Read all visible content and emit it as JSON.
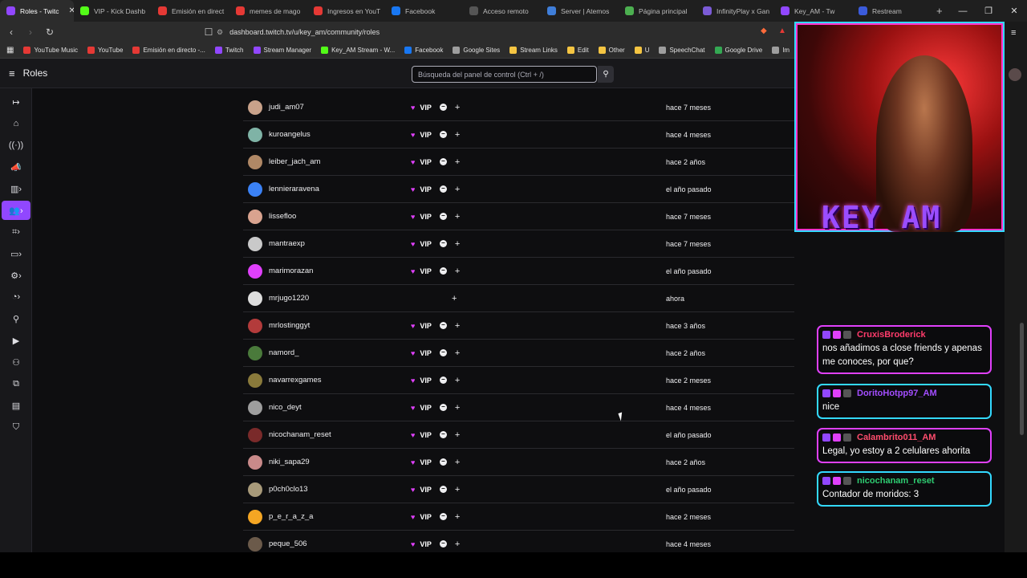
{
  "tabs": [
    {
      "label": "Roles - Twitc",
      "color": "#9147ff",
      "active": true
    },
    {
      "label": "VIP - Kick Dashb",
      "color": "#53fc18"
    },
    {
      "label": "Emisión en direct",
      "color": "#e53935"
    },
    {
      "label": "memes de mago",
      "color": "#e53935"
    },
    {
      "label": "Ingresos en YouT",
      "color": "#e53935"
    },
    {
      "label": "Facebook",
      "color": "#1877f2"
    },
    {
      "label": "Acceso remoto",
      "color": "#555555"
    },
    {
      "label": "Server | Atemos",
      "color": "#3f7ed9"
    },
    {
      "label": "Página principal",
      "color": "#4caf50"
    },
    {
      "label": "InfinityPlay x Gan",
      "color": "#7b5bd6"
    },
    {
      "label": "Key_AM - Tw",
      "color": "#9147ff"
    },
    {
      "label": "Restream",
      "color": "#3b5bdb"
    }
  ],
  "address": {
    "url": "dashboard.twitch.tv/u/key_am/community/roles"
  },
  "bookmarks": [
    {
      "label": "YouTube Music",
      "color": "#e53935"
    },
    {
      "label": "YouTube",
      "color": "#e53935"
    },
    {
      "label": "Emisión en directo -...",
      "color": "#e53935"
    },
    {
      "label": "Twitch",
      "color": "#9147ff"
    },
    {
      "label": "Stream Manager",
      "color": "#9147ff"
    },
    {
      "label": "Key_AM Stream - W...",
      "color": "#53fc18"
    },
    {
      "label": "Facebook",
      "color": "#1877f2"
    },
    {
      "label": "Google Sites",
      "color": "#9e9e9e"
    },
    {
      "label": "Stream Links",
      "color": "#f5c542"
    },
    {
      "label": "Edit",
      "color": "#f5c542"
    },
    {
      "label": "Other",
      "color": "#f5c542"
    },
    {
      "label": "U",
      "color": "#f5c542"
    },
    {
      "label": "SpeechChat",
      "color": "#9e9e9e"
    },
    {
      "label": "Google Drive",
      "color": "#34a853"
    },
    {
      "label": "Im",
      "color": "#9e9e9e"
    }
  ],
  "header": {
    "title": "Roles",
    "search_placeholder": "Búsqueda del panel de control (Ctrl + /)"
  },
  "roles": [
    {
      "user": "judi_am07",
      "vip": true,
      "date": "hace 7 meses",
      "avatar": "#c9a28a"
    },
    {
      "user": "kuroangelus",
      "vip": true,
      "date": "hace 4 meses",
      "avatar": "#7fb3a6"
    },
    {
      "user": "leiber_jach_am",
      "vip": true,
      "date": "hace 2 años",
      "avatar": "#b08866"
    },
    {
      "user": "lennieraravena",
      "vip": true,
      "date": "el año pasado",
      "avatar": "#3b82f6"
    },
    {
      "user": "lissefloo",
      "vip": true,
      "date": "hace 7 meses",
      "avatar": "#d9a38f"
    },
    {
      "user": "mantraexp",
      "vip": true,
      "date": "hace 7 meses",
      "avatar": "#c9c9c9"
    },
    {
      "user": "marimorazan",
      "vip": true,
      "date": "el año pasado",
      "avatar": "#e040fb"
    },
    {
      "user": "mrjugo1220",
      "vip": false,
      "date": "ahora",
      "avatar": "#dddddd"
    },
    {
      "user": "mrlostinggyt",
      "vip": true,
      "date": "hace 3 años",
      "avatar": "#b33b3b"
    },
    {
      "user": "namord_",
      "vip": true,
      "date": "hace 2 años",
      "avatar": "#4a7a3b"
    },
    {
      "user": "navarrexgames",
      "vip": true,
      "date": "hace 2 meses",
      "avatar": "#8a7a3b"
    },
    {
      "user": "nico_deyt",
      "vip": true,
      "date": "hace 4 meses",
      "avatar": "#9e9e9e"
    },
    {
      "user": "nicochanam_reset",
      "vip": true,
      "date": "el año pasado",
      "avatar": "#7a2a2a"
    },
    {
      "user": "niki_sapa29",
      "vip": true,
      "date": "hace 2 años",
      "avatar": "#c98a8a"
    },
    {
      "user": "p0ch0clo13",
      "vip": true,
      "date": "el año pasado",
      "avatar": "#a89a7a"
    },
    {
      "user": "p_e_r_a_z_a",
      "vip": true,
      "date": "hace 2 meses",
      "avatar": "#f5a623"
    },
    {
      "user": "peque_506",
      "vip": true,
      "date": "hace 4 meses",
      "avatar": "#6b5a4a"
    }
  ],
  "vip_label": "VIP",
  "webcam": {
    "brand": "KEY_AM"
  },
  "chat": [
    {
      "user": "CruxisBroderick",
      "color": "#ff3b6b",
      "border": "#e040fb",
      "message": "nos añadimos a close friends y apenas me conoces, por que?"
    },
    {
      "user": "DoritoHotpp97_AM",
      "color": "#a34dff",
      "border": "#33d9ff",
      "message": "nice"
    },
    {
      "user": "Calambrito011_AM",
      "color": "#ff4d6d",
      "border": "#e040fb",
      "message": "Legal, yo estoy a 2 celulares ahorita"
    },
    {
      "user": "nicochanam_reset",
      "color": "#2ecc71",
      "border": "#33d9ff",
      "message": "Contador de moridos: 3"
    }
  ]
}
